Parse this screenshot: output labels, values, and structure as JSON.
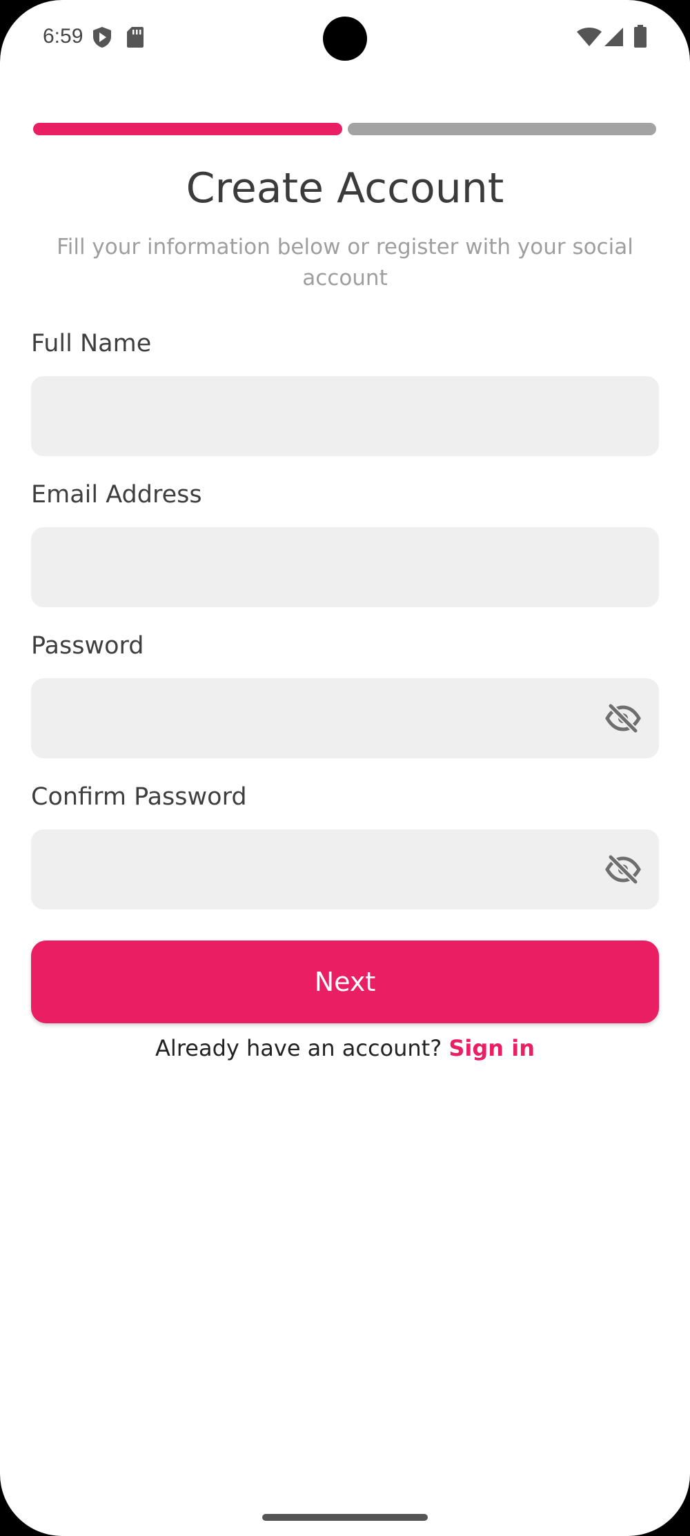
{
  "status_bar": {
    "time": "6:59",
    "icons_left": [
      "shield-play-icon",
      "sd-card-icon"
    ],
    "icons_right": [
      "wifi-icon",
      "signal-icon",
      "battery-icon"
    ]
  },
  "progress": {
    "steps_total": 2,
    "current_step": 1,
    "active_color": "#e91e63",
    "inactive_color": "#a3a3a3"
  },
  "header": {
    "title": "Create Account",
    "subtitle": "Fill your information below or register with your social account"
  },
  "form": {
    "full_name": {
      "label": "Full Name",
      "value": ""
    },
    "email": {
      "label": "Email Address",
      "value": ""
    },
    "password": {
      "label": "Password",
      "value": "",
      "toggle_icon": "eye-off-icon"
    },
    "confirm_password": {
      "label": "Confirm Password",
      "value": "",
      "toggle_icon": "eye-off-icon"
    }
  },
  "actions": {
    "next_label": "Next",
    "signin_prompt": "Already have an account?",
    "signin_link": "Sign in"
  },
  "colors": {
    "accent": "#e91e63",
    "field_bg": "#efefef",
    "title": "#3b3b3b",
    "subtitle": "#9e9e9e"
  }
}
